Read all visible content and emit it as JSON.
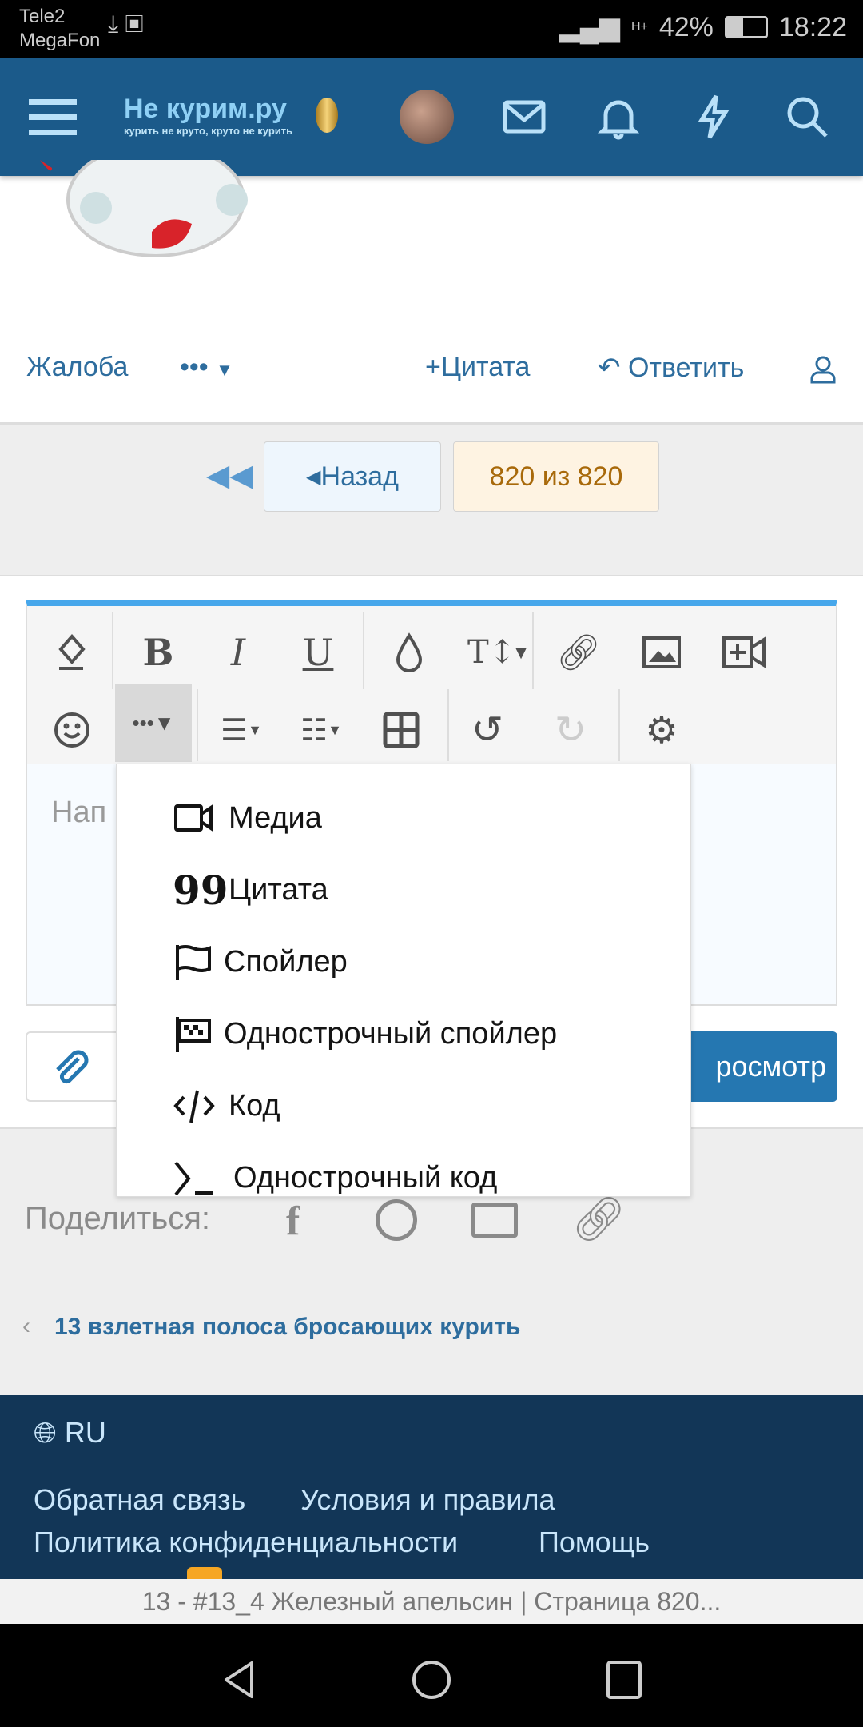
{
  "status_bar": {
    "carrier1": "Tele2",
    "carrier2": "MegaFon",
    "network": "H+",
    "battery": "42%",
    "time": "18:22"
  },
  "header": {
    "logo_title": "Не курим.ру",
    "logo_tagline": "курить не круто, круто не курить"
  },
  "post_actions": {
    "report": "Жалоба",
    "more": "•••",
    "quote": "Цитата",
    "reply": "Ответить"
  },
  "pager": {
    "back": "Назад",
    "current": "820 из 820"
  },
  "editor": {
    "placeholder": "Нап",
    "more_menu": [
      {
        "icon": "video-icon",
        "label": "Медиа"
      },
      {
        "icon": "quote-icon",
        "label": "Цитата"
      },
      {
        "icon": "flag-icon",
        "label": "Спойлер"
      },
      {
        "icon": "checkered-flag-icon",
        "label": "Однострочный спойлер"
      },
      {
        "icon": "code-icon",
        "label": "Код"
      },
      {
        "icon": "terminal-icon",
        "label": "Однострочный код"
      }
    ],
    "preview_label": "росмотр"
  },
  "share": {
    "label": "Поделиться:"
  },
  "prev_thread": {
    "label": "13 взлетная полоса бросающих курить"
  },
  "footer": {
    "language": "RU",
    "links": [
      "Обратная связь",
      "Условия и правила",
      "Политика конфиденциальности",
      "Помощь"
    ]
  },
  "browser": {
    "page_title": "13 - #13_4 Железный апельсин | Страница 820..."
  },
  "colors": {
    "header": "#1b5a8a",
    "accent": "#47a7eb",
    "button": "#2577b1",
    "footer": "#123657",
    "pager_current": "#fef3e2"
  }
}
